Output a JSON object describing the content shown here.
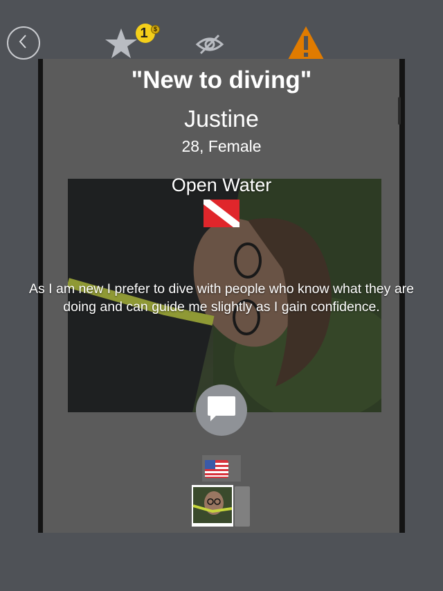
{
  "toolbar": {
    "back_icon": "chevron-left-icon",
    "favorite_icon": "star-icon",
    "coin_count": "1",
    "coin_symbol": "$",
    "hide_icon": "eye-slash-icon",
    "report_icon": "warning-icon"
  },
  "profile": {
    "headline": "\"New to diving\"",
    "name": "Justine",
    "age_gender": "28, Female",
    "certification": "Open Water",
    "bio": "As I am new I prefer to dive with people who know what they are doing and can guide me slightly as I gain confidence."
  },
  "actions": {
    "chat_icon": "chat-bubble-icon"
  },
  "languages": [
    "us-flag-icon"
  ],
  "colors": {
    "background": "#4f5257",
    "card": "#5b5b5b",
    "warning": "#e07b00",
    "badge": "#f4cf1a",
    "dive_flag_red": "#e0262b"
  }
}
